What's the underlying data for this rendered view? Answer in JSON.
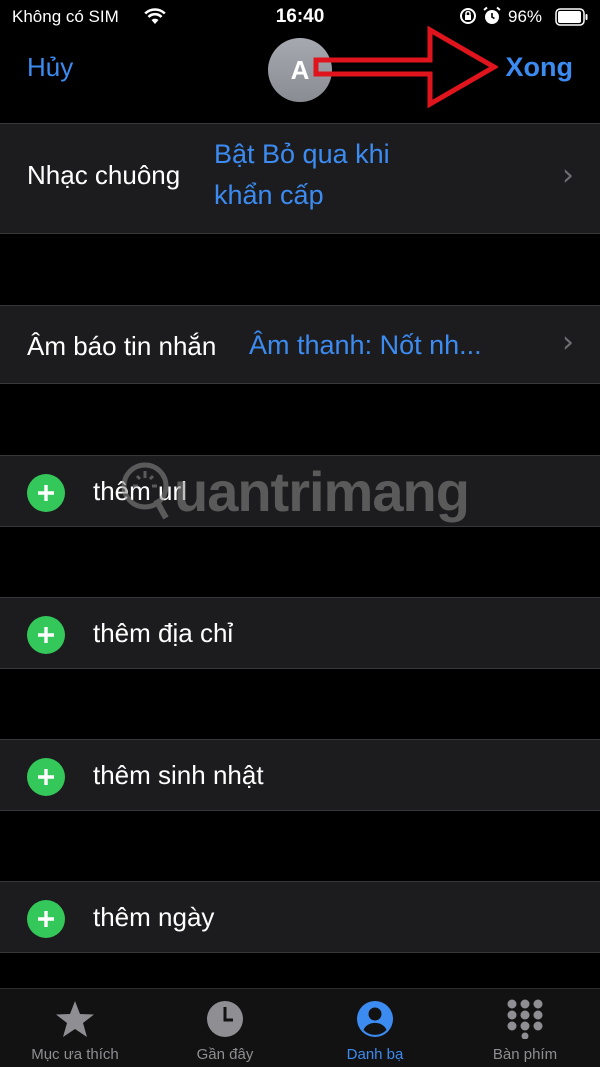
{
  "status_bar": {
    "carrier": "Không có SIM",
    "time": "16:40",
    "battery": "96%"
  },
  "nav": {
    "cancel_label": "Hủy",
    "avatar_initial": "A",
    "done_label": "Xong"
  },
  "ringtone": {
    "label": "Nhạc chuông",
    "value_line1": "Bật Bỏ qua khi",
    "value_line2": "khẩn cấp"
  },
  "text_tone": {
    "label": "Âm báo tin nhắn",
    "value": "Âm thanh: Nốt nh..."
  },
  "add_rows": [
    {
      "label": "thêm url"
    },
    {
      "label": "thêm địa chỉ"
    },
    {
      "label": "thêm sinh nhật"
    },
    {
      "label": "thêm ngày"
    }
  ],
  "watermark": "uantrimang",
  "tabs": [
    {
      "label": "Mục ưa thích",
      "icon": "star-icon",
      "active": false
    },
    {
      "label": "Gần đây",
      "icon": "clock-icon",
      "active": false
    },
    {
      "label": "Danh bạ",
      "icon": "contact-icon",
      "active": true
    },
    {
      "label": "Bàn phím",
      "icon": "keypad-icon",
      "active": false
    }
  ],
  "colors": {
    "accent": "#3c8bf0",
    "add_green": "#34c759",
    "row_bg": "#1c1c1e",
    "annotation_arrow": "#e0141c"
  }
}
